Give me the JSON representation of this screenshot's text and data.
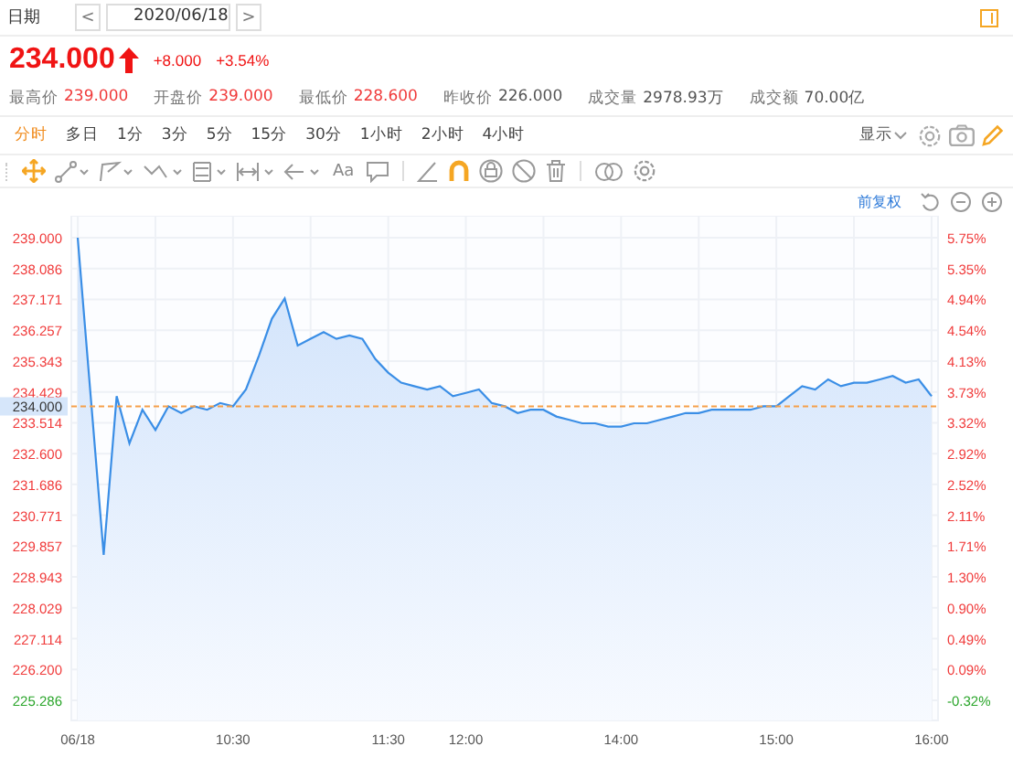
{
  "date_bar": {
    "label": "日期",
    "prev": "<",
    "date": "2020/06/18",
    "next": ">"
  },
  "quote": {
    "price": "234.000",
    "change": "+8.000",
    "change_pct": "+3.54%",
    "up": true
  },
  "stats": [
    {
      "label": "最高价",
      "value": "239.000",
      "color": "#f03a3a"
    },
    {
      "label": "开盘价",
      "value": "239.000",
      "color": "#f03a3a"
    },
    {
      "label": "最低价",
      "value": "228.600",
      "color": "#f03a3a"
    },
    {
      "label": "昨收价",
      "value": "226.000",
      "color": "#555555"
    },
    {
      "label": "成交量",
      "value": "2978.93万",
      "color": "#555555"
    },
    {
      "label": "成交额",
      "value": "70.00亿",
      "color": "#555555"
    }
  ],
  "periods": [
    {
      "label": "分时",
      "selected": true
    },
    {
      "label": "多日",
      "selected": false
    },
    {
      "label": "1分",
      "selected": false
    },
    {
      "label": "3分",
      "selected": false
    },
    {
      "label": "5分",
      "selected": false
    },
    {
      "label": "15分",
      "selected": false
    },
    {
      "label": "30分",
      "selected": false
    },
    {
      "label": "1小时",
      "selected": false
    },
    {
      "label": "2小时",
      "selected": false
    },
    {
      "label": "4小时",
      "selected": false
    }
  ],
  "display_menu": {
    "label": "显示"
  },
  "drawing_tools": [
    {
      "kind": "move",
      "selected": true
    },
    {
      "kind": "line",
      "selected": false
    },
    {
      "kind": "polyline",
      "selected": false
    },
    {
      "kind": "wave",
      "selected": false
    },
    {
      "kind": "fib",
      "selected": false
    },
    {
      "kind": "measure",
      "selected": false
    },
    {
      "kind": "arrow",
      "selected": false
    },
    {
      "kind": "text",
      "label": "Aa",
      "selected": false
    },
    {
      "kind": "note",
      "selected": false
    },
    {
      "kind": "sep"
    },
    {
      "kind": "angle",
      "selected": false
    },
    {
      "kind": "magnet",
      "selected": true
    },
    {
      "kind": "lock",
      "selected": false
    },
    {
      "kind": "hide",
      "selected": false
    },
    {
      "kind": "trash",
      "selected": false
    },
    {
      "kind": "sep"
    },
    {
      "kind": "overlay",
      "selected": false
    },
    {
      "kind": "settings",
      "selected": false
    }
  ],
  "adjust_link": "前复权",
  "chart": {
    "chart_data": {
      "type": "area",
      "categories": [
        "06/18",
        null,
        null,
        null,
        null,
        null,
        null,
        null,
        null,
        null,
        null,
        null,
        "10:30",
        null,
        null,
        null,
        null,
        null,
        null,
        null,
        null,
        null,
        null,
        null,
        "11:30",
        null,
        null,
        null,
        null,
        null,
        "12:00",
        null,
        null,
        null,
        null,
        null,
        null,
        null,
        null,
        null,
        null,
        null,
        "14:00",
        null,
        null,
        null,
        null,
        null,
        null,
        null,
        null,
        null,
        null,
        null,
        "15:00",
        null,
        null,
        null,
        null,
        null,
        null,
        null,
        null,
        null,
        null,
        null,
        "16:00"
      ],
      "series": [
        {
          "color": "#3a8ee6",
          "values": [
            239.0,
            234.3,
            229.6,
            234.3,
            232.9,
            233.9,
            233.3,
            234.0,
            233.8,
            234.0,
            233.9,
            234.1,
            234.0,
            234.5,
            235.5,
            236.6,
            237.2,
            235.8,
            236.0,
            236.2,
            236.0,
            236.1,
            236.0,
            235.4,
            235.0,
            234.7,
            234.6,
            234.5,
            234.6,
            234.3,
            234.4,
            234.5,
            234.1,
            234.0,
            233.8,
            233.9,
            233.9,
            233.7,
            233.6,
            233.5,
            233.5,
            233.4,
            233.4,
            233.5,
            233.5,
            233.6,
            233.7,
            233.8,
            233.8,
            233.9,
            233.9,
            233.9,
            233.9,
            234.0,
            234.0,
            234.3,
            234.6,
            234.5,
            234.8,
            234.6,
            234.7,
            234.7,
            234.8,
            234.9,
            234.7,
            234.8,
            234.3
          ]
        }
      ],
      "ylim": [
        224.69,
        239.65
      ],
      "yticks": [
        {
          "value": 239.0,
          "label": "239.000"
        },
        {
          "value": 238.086,
          "label": "238.086"
        },
        {
          "value": 237.171,
          "label": "237.171"
        },
        {
          "value": 236.257,
          "label": "236.257"
        },
        {
          "value": 235.343,
          "label": "235.343"
        },
        {
          "value": 234.429,
          "label": "234.429"
        },
        {
          "value": 233.514,
          "label": "233.514"
        },
        {
          "value": 232.6,
          "label": "232.600"
        },
        {
          "value": 231.686,
          "label": "231.686"
        },
        {
          "value": 230.771,
          "label": "230.771"
        },
        {
          "value": 229.857,
          "label": "229.857"
        },
        {
          "value": 228.943,
          "label": "228.943"
        },
        {
          "value": 228.029,
          "label": "228.029"
        },
        {
          "value": 227.114,
          "label": "227.114"
        },
        {
          "value": 226.2,
          "label": "226.200"
        },
        {
          "value": 225.286,
          "label": "225.286"
        }
      ],
      "grid": true,
      "ref_lines": [
        {
          "axis": "y",
          "value": 234.0,
          "label": "234.000"
        }
      ]
    },
    "right_axis": [
      "5.75%",
      "5.35%",
      "4.94%",
      "4.54%",
      "4.13%",
      "3.73%",
      "3.32%",
      "2.92%",
      "2.52%",
      "2.11%",
      "1.71%",
      "1.30%",
      "0.90%",
      "0.49%",
      "0.09%",
      "-0.32%"
    ]
  }
}
